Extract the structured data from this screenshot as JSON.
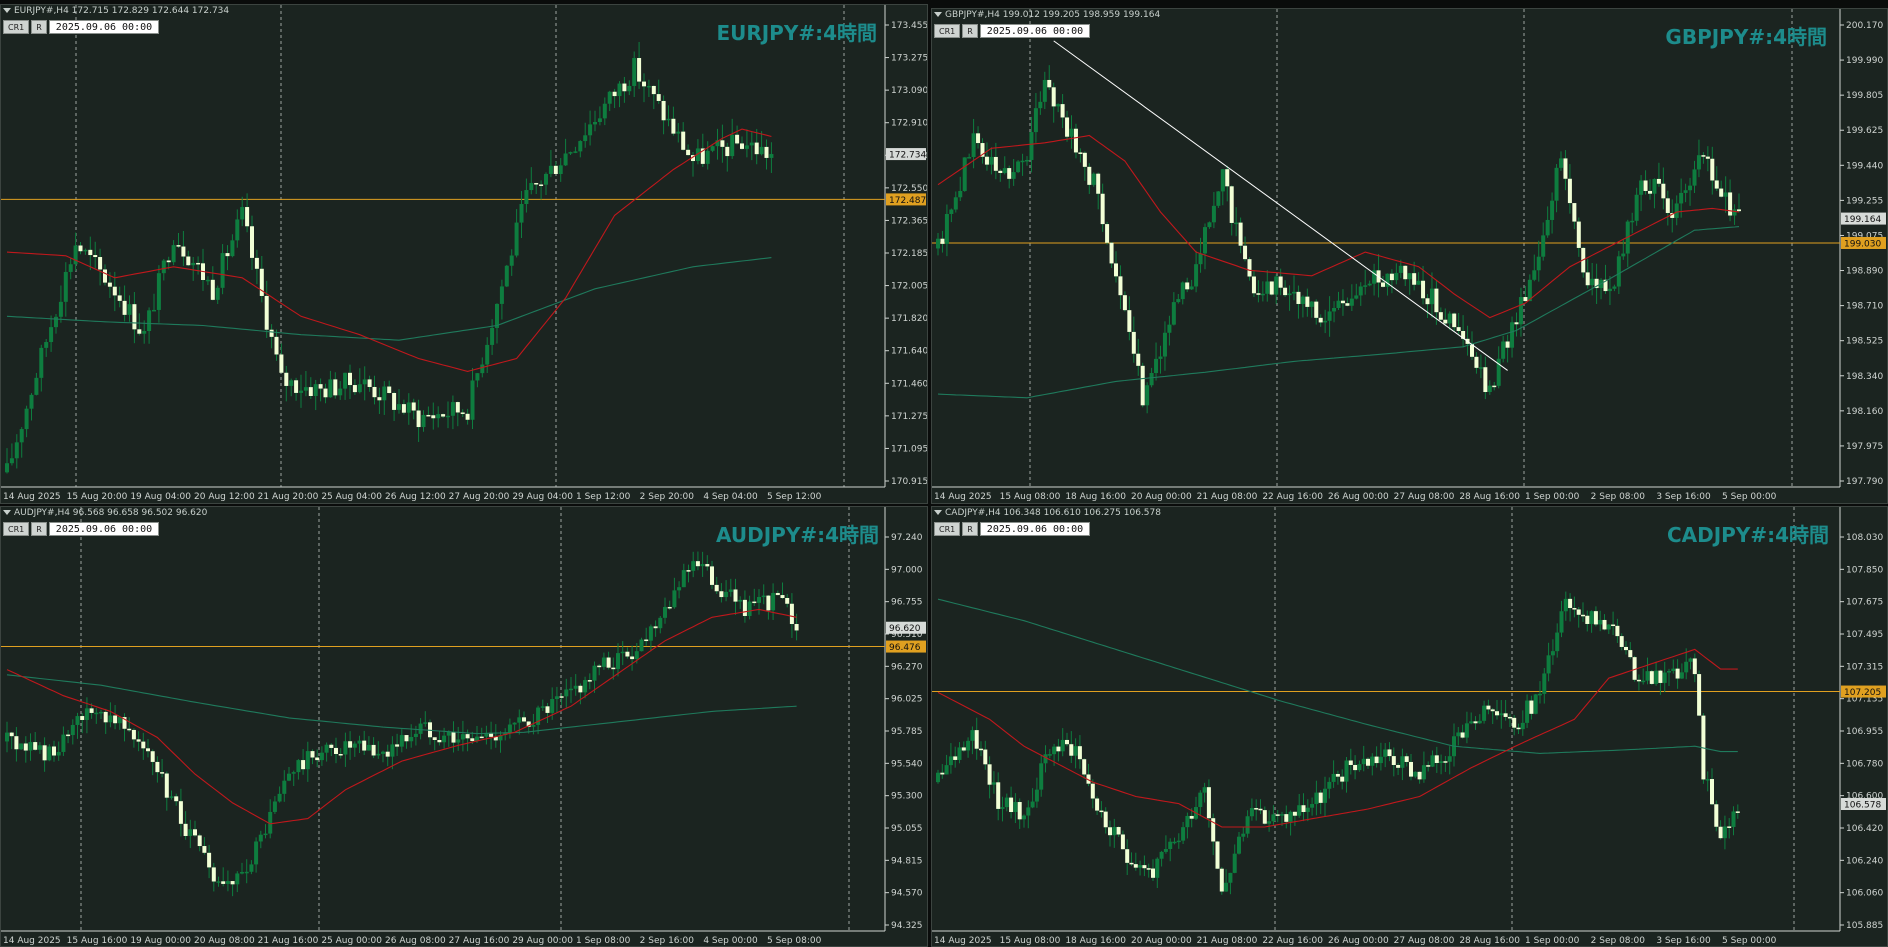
{
  "colors": {
    "background": "#1b2420",
    "grid": "#c8d0cc",
    "bull": "#0e7d3f",
    "bear": "#f2ffd6",
    "ma_fast": "#c0181c",
    "ma_slow": "#1f7a5c",
    "level_line": "#e0a020",
    "title": "#1d8c8c"
  },
  "charts": [
    {
      "id": "eurjpy",
      "header": "EURJPY#,H4  172.715 172.829 172.644 172.734",
      "tool_cr1": "CR1",
      "tool_r": "R",
      "datetime": "2025.09.06 00:00",
      "title": "EURJPY#:4時間",
      "ylim": [
        170.92,
        173.47
      ],
      "price_ticks": [
        "173.455",
        "173.275",
        "173.090",
        "172.910",
        "172.730",
        "172.550",
        "172.365",
        "172.185",
        "172.005",
        "171.820",
        "171.640",
        "171.460",
        "171.275",
        "171.095",
        "170.915"
      ],
      "time_labels": [
        "14 Aug 2025",
        "15 Aug 20:00",
        "19 Aug 04:00",
        "20 Aug 12:00",
        "21 Aug 20:00",
        "25 Aug 04:00",
        "26 Aug 12:00",
        "27 Aug 20:00",
        "29 Aug 04:00",
        "1 Sep 12:00",
        "2 Sep 20:00",
        "4 Sep 04:00",
        "5 Sep 12:00"
      ],
      "current_price": "172.734",
      "level": "172.487",
      "level_value": 172.487,
      "trendline": null,
      "chart_data": {
        "type": "candlestick",
        "anchors": [
          [
            0,
            171.0
          ],
          [
            10,
            171.9
          ],
          [
            14,
            172.25
          ],
          [
            22,
            172.0
          ],
          [
            28,
            171.75
          ],
          [
            34,
            172.3
          ],
          [
            42,
            172.0
          ],
          [
            48,
            172.4
          ],
          [
            56,
            171.5
          ],
          [
            64,
            171.45
          ],
          [
            72,
            171.5
          ],
          [
            84,
            171.3
          ],
          [
            94,
            171.35
          ],
          [
            106,
            172.5
          ],
          [
            116,
            172.8
          ],
          [
            128,
            173.2
          ],
          [
            140,
            172.7
          ],
          [
            150,
            172.8
          ],
          [
            156,
            172.73
          ]
        ],
        "ma_fast_anchors": [
          [
            0,
            172.2
          ],
          [
            12,
            172.18
          ],
          [
            22,
            172.06
          ],
          [
            34,
            172.12
          ],
          [
            48,
            172.06
          ],
          [
            60,
            171.85
          ],
          [
            72,
            171.75
          ],
          [
            84,
            171.62
          ],
          [
            94,
            171.55
          ],
          [
            104,
            171.62
          ],
          [
            114,
            171.95
          ],
          [
            124,
            172.4
          ],
          [
            136,
            172.65
          ],
          [
            146,
            172.82
          ],
          [
            150,
            172.87
          ],
          [
            156,
            172.83
          ]
        ],
        "ma_slow_anchors": [
          [
            0,
            171.85
          ],
          [
            20,
            171.82
          ],
          [
            40,
            171.8
          ],
          [
            60,
            171.75
          ],
          [
            80,
            171.72
          ],
          [
            100,
            171.8
          ],
          [
            120,
            172.0
          ],
          [
            140,
            172.12
          ],
          [
            156,
            172.17
          ]
        ]
      }
    },
    {
      "id": "gbpjpy",
      "header": "GBPJPY#,H4  199.012 199.205 198.959 199.164",
      "tool_cr1": "CR1",
      "tool_r": "R",
      "datetime": "2025.09.06 00:00",
      "title": "GBPJPY#:4時間",
      "ylim": [
        197.69,
        200.26
      ],
      "price_ticks": [
        "200.170",
        "199.990",
        "199.805",
        "199.625",
        "199.440",
        "199.255",
        "199.075",
        "198.890",
        "198.710",
        "198.525",
        "198.340",
        "198.160",
        "197.975",
        "197.790"
      ],
      "time_labels": [
        "14 Aug 2025",
        "15 Aug 08:00",
        "18 Aug 16:00",
        "20 Aug 00:00",
        "21 Aug 08:00",
        "22 Aug 16:00",
        "26 Aug 00:00",
        "27 Aug 08:00",
        "28 Aug 16:00",
        "1 Sep 00:00",
        "2 Sep 08:00",
        "3 Sep 16:00",
        "5 Sep 00:00"
      ],
      "current_price": "199.164",
      "level": "199.030",
      "level_value": 199.03,
      "trendline": {
        "from": [
          26,
          200.14
        ],
        "to": [
          128,
          198.33
        ]
      },
      "chart_data": {
        "type": "candlestick",
        "anchors": [
          [
            0,
            199.0
          ],
          [
            8,
            199.6
          ],
          [
            14,
            199.4
          ],
          [
            20,
            199.5
          ],
          [
            24,
            199.95
          ],
          [
            30,
            199.6
          ],
          [
            36,
            199.3
          ],
          [
            42,
            198.6
          ],
          [
            46,
            198.2
          ],
          [
            52,
            198.6
          ],
          [
            58,
            198.9
          ],
          [
            64,
            199.4
          ],
          [
            70,
            198.8
          ],
          [
            78,
            198.8
          ],
          [
            86,
            198.6
          ],
          [
            96,
            198.8
          ],
          [
            104,
            198.9
          ],
          [
            112,
            198.7
          ],
          [
            118,
            198.5
          ],
          [
            124,
            198.2
          ],
          [
            128,
            198.5
          ],
          [
            134,
            198.9
          ],
          [
            140,
            199.5
          ],
          [
            146,
            198.8
          ],
          [
            152,
            198.8
          ],
          [
            158,
            199.4
          ],
          [
            166,
            199.2
          ],
          [
            172,
            199.5
          ],
          [
            176,
            199.3
          ],
          [
            180,
            199.16
          ]
        ],
        "ma_fast_anchors": [
          [
            0,
            199.35
          ],
          [
            12,
            199.55
          ],
          [
            24,
            199.58
          ],
          [
            34,
            199.62
          ],
          [
            42,
            199.48
          ],
          [
            50,
            199.2
          ],
          [
            58,
            198.98
          ],
          [
            70,
            198.88
          ],
          [
            84,
            198.85
          ],
          [
            96,
            198.98
          ],
          [
            108,
            198.9
          ],
          [
            116,
            198.75
          ],
          [
            124,
            198.62
          ],
          [
            132,
            198.7
          ],
          [
            142,
            198.9
          ],
          [
            154,
            199.05
          ],
          [
            166,
            199.2
          ],
          [
            174,
            199.22
          ],
          [
            180,
            199.2
          ]
        ],
        "ma_slow_anchors": [
          [
            0,
            198.2
          ],
          [
            20,
            198.18
          ],
          [
            40,
            198.27
          ],
          [
            60,
            198.32
          ],
          [
            80,
            198.38
          ],
          [
            100,
            198.42
          ],
          [
            118,
            198.46
          ],
          [
            130,
            198.55
          ],
          [
            150,
            198.82
          ],
          [
            170,
            199.1
          ],
          [
            180,
            199.12
          ]
        ]
      }
    },
    {
      "id": "audjpy",
      "header": "AUDJPY#,H4  96.568 96.658 96.502 96.620",
      "tool_cr1": "CR1",
      "tool_r": "R",
      "datetime": "2025.09.06 00:00",
      "title": "AUDJPY#:4時間",
      "ylim": [
        94.3,
        97.36
      ],
      "price_ticks": [
        "97.240",
        "97.000",
        "96.755",
        "96.510",
        "96.270",
        "96.025",
        "95.785",
        "95.540",
        "95.300",
        "95.055",
        "94.815",
        "94.570",
        "94.325"
      ],
      "time_labels": [
        "14 Aug 2025",
        "15 Aug 16:00",
        "19 Aug 00:00",
        "20 Aug 08:00",
        "21 Aug 16:00",
        "25 Aug 00:00",
        "26 Aug 08:00",
        "27 Aug 16:00",
        "29 Aug 00:00",
        "1 Sep 08:00",
        "2 Sep 16:00",
        "4 Sep 00:00",
        "5 Sep 08:00"
      ],
      "current_price": "96.620",
      "level": "96.476",
      "level_value": 96.476,
      "trendline": null,
      "chart_data": {
        "type": "candlestick",
        "anchors": [
          [
            0,
            95.75
          ],
          [
            10,
            95.65
          ],
          [
            18,
            96.0
          ],
          [
            26,
            95.9
          ],
          [
            32,
            95.5
          ],
          [
            38,
            95.1
          ],
          [
            44,
            94.7
          ],
          [
            48,
            94.6
          ],
          [
            54,
            95.0
          ],
          [
            60,
            95.5
          ],
          [
            66,
            95.65
          ],
          [
            72,
            95.7
          ],
          [
            80,
            95.65
          ],
          [
            88,
            95.85
          ],
          [
            98,
            95.75
          ],
          [
            108,
            95.85
          ],
          [
            118,
            96.05
          ],
          [
            126,
            96.3
          ],
          [
            134,
            96.45
          ],
          [
            142,
            96.9
          ],
          [
            146,
            97.15
          ],
          [
            152,
            96.9
          ],
          [
            158,
            96.75
          ],
          [
            164,
            96.85
          ],
          [
            168,
            96.62
          ]
        ],
        "ma_fast_anchors": [
          [
            0,
            96.3
          ],
          [
            12,
            96.1
          ],
          [
            22,
            95.98
          ],
          [
            32,
            95.78
          ],
          [
            40,
            95.5
          ],
          [
            48,
            95.28
          ],
          [
            56,
            95.12
          ],
          [
            64,
            95.16
          ],
          [
            72,
            95.38
          ],
          [
            84,
            95.6
          ],
          [
            96,
            95.72
          ],
          [
            108,
            95.82
          ],
          [
            120,
            96.02
          ],
          [
            130,
            96.27
          ],
          [
            140,
            96.52
          ],
          [
            150,
            96.7
          ],
          [
            160,
            96.76
          ],
          [
            168,
            96.7
          ]
        ],
        "ma_slow_anchors": [
          [
            0,
            96.26
          ],
          [
            20,
            96.18
          ],
          [
            40,
            96.05
          ],
          [
            60,
            95.93
          ],
          [
            80,
            95.86
          ],
          [
            100,
            95.81
          ],
          [
            110,
            95.82
          ],
          [
            130,
            95.9
          ],
          [
            150,
            95.98
          ],
          [
            168,
            96.02
          ]
        ]
      }
    },
    {
      "id": "cadjpy",
      "header": "CADJPY#,H4  106.348 106.610 106.275 106.578",
      "tool_cr1": "CR1",
      "tool_r": "R",
      "datetime": "2025.09.06 00:00",
      "title": "CADJPY#:4時間",
      "ylim": [
        105.87,
        108.1
      ],
      "price_ticks": [
        "108.030",
        "107.850",
        "107.675",
        "107.495",
        "107.315",
        "107.135",
        "106.955",
        "106.780",
        "106.600",
        "106.420",
        "106.240",
        "106.060",
        "105.885"
      ],
      "time_labels": [
        "14 Aug 2025",
        "15 Aug 08:00",
        "18 Aug 16:00",
        "20 Aug 00:00",
        "21 Aug 08:00",
        "22 Aug 16:00",
        "26 Aug 00:00",
        "27 Aug 08:00",
        "28 Aug 16:00",
        "1 Sep 00:00",
        "2 Sep 08:00",
        "3 Sep 16:00",
        "5 Sep 00:00"
      ],
      "current_price": "106.578",
      "level": "107.205",
      "level_value": 107.205,
      "trendline": null,
      "chart_data": {
        "type": "candlestick",
        "anchors": [
          [
            0,
            106.7
          ],
          [
            8,
            107.0
          ],
          [
            14,
            106.6
          ],
          [
            20,
            106.5
          ],
          [
            26,
            106.9
          ],
          [
            32,
            106.9
          ],
          [
            38,
            106.5
          ],
          [
            44,
            106.3
          ],
          [
            50,
            106.2
          ],
          [
            56,
            106.4
          ],
          [
            62,
            106.7
          ],
          [
            66,
            106.1
          ],
          [
            72,
            106.5
          ],
          [
            80,
            106.5
          ],
          [
            88,
            106.6
          ],
          [
            96,
            106.8
          ],
          [
            104,
            106.85
          ],
          [
            112,
            106.75
          ],
          [
            120,
            106.9
          ],
          [
            128,
            107.1
          ],
          [
            134,
            107.0
          ],
          [
            140,
            107.2
          ],
          [
            146,
            107.75
          ],
          [
            152,
            107.6
          ],
          [
            156,
            107.6
          ],
          [
            162,
            107.3
          ],
          [
            170,
            107.3
          ],
          [
            176,
            107.35
          ],
          [
            178,
            106.75
          ],
          [
            182,
            106.4
          ],
          [
            186,
            106.58
          ]
        ],
        "ma_fast_anchors": [
          [
            0,
            107.2
          ],
          [
            12,
            107.05
          ],
          [
            20,
            106.9
          ],
          [
            28,
            106.8
          ],
          [
            36,
            106.7
          ],
          [
            46,
            106.62
          ],
          [
            56,
            106.58
          ],
          [
            66,
            106.45
          ],
          [
            76,
            106.45
          ],
          [
            88,
            106.5
          ],
          [
            100,
            106.55
          ],
          [
            112,
            106.62
          ],
          [
            124,
            106.78
          ],
          [
            136,
            106.92
          ],
          [
            148,
            107.05
          ],
          [
            156,
            107.28
          ],
          [
            166,
            107.36
          ],
          [
            176,
            107.44
          ],
          [
            182,
            107.33
          ]
        ],
        "ma_slow_anchors": [
          [
            0,
            107.72
          ],
          [
            20,
            107.6
          ],
          [
            40,
            107.45
          ],
          [
            60,
            107.3
          ],
          [
            80,
            107.15
          ],
          [
            100,
            107.02
          ],
          [
            120,
            106.9
          ],
          [
            140,
            106.86
          ],
          [
            160,
            106.88
          ],
          [
            176,
            106.9
          ],
          [
            182,
            106.87
          ]
        ]
      }
    }
  ]
}
